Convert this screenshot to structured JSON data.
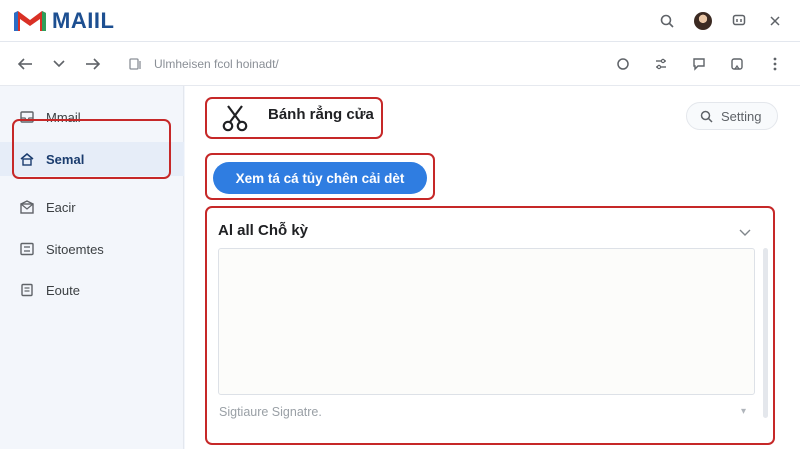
{
  "app": {
    "name": "MAIIL"
  },
  "address_bar": {
    "text": "Ulmheisen fcol hoinadt/"
  },
  "sidebar": {
    "items": [
      {
        "label": "Mmail",
        "icon": "inbox-icon",
        "active": false
      },
      {
        "label": "Semal",
        "icon": "home-icon",
        "active": true
      },
      {
        "label": "Eacir",
        "icon": "mail-open-icon",
        "active": false
      },
      {
        "label": "Sitoemtes",
        "icon": "list-icon",
        "active": false
      },
      {
        "label": "Eoute",
        "icon": "document-icon",
        "active": false
      }
    ]
  },
  "page": {
    "title": "Bánh rẳng cửa",
    "title_icon": "scissors-icon",
    "setting_button": "Setting",
    "primary_button": "Xem tá cá tủy chên cải dèt",
    "section_title": "Al all Chỗ kỳ",
    "signature_caption": "Sigtiaure Signatre."
  },
  "colors": {
    "accent": "#2f7de1",
    "highlight_outline": "#c62828",
    "logo_blue": "#1d4f91",
    "logo_red": "#d93025"
  }
}
